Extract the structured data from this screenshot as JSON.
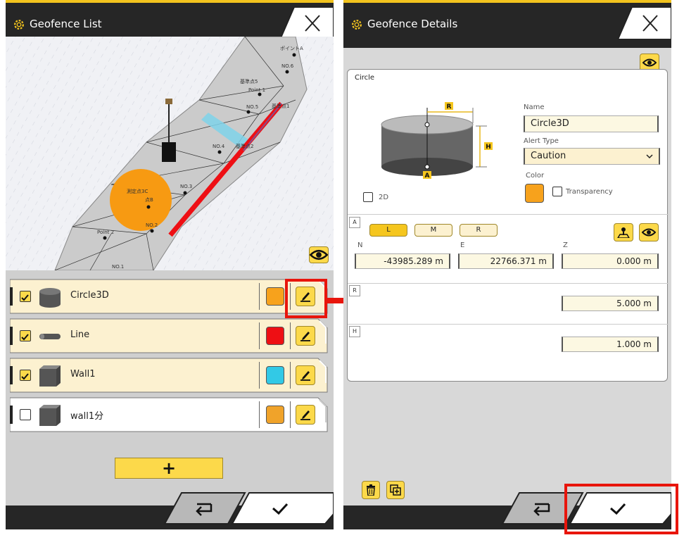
{
  "left": {
    "title": "Geofence List",
    "map_labels": [
      "ポイントA",
      "NO.6",
      "基準点5",
      "Point 1",
      "NO.5",
      "基準点1",
      "NO.4",
      "基準点2",
      "NO.3",
      "Point 2",
      "NO.2",
      "NO.1",
      "測定点3C",
      "点B"
    ],
    "items": [
      {
        "name": "Circle3D",
        "checked": true,
        "color": "#f7a21c",
        "icon": "cylinder-icon"
      },
      {
        "name": "Line",
        "checked": true,
        "color": "#ee0f14",
        "icon": "line-icon"
      },
      {
        "name": "Wall1",
        "checked": true,
        "color": "#32c9e6",
        "icon": "box-icon"
      },
      {
        "name": "wall1分",
        "checked": false,
        "color": "#f0a32a",
        "icon": "box-icon"
      }
    ],
    "add_label": "+"
  },
  "right": {
    "title": "Geofence Details",
    "tab_label": "Circle",
    "diagram_labels": {
      "r": "R",
      "h": "H",
      "a": "A"
    },
    "name_label": "Name",
    "name_value": "Circle3D",
    "alert_label": "Alert Type",
    "alert_value": "Caution",
    "color_label": "Color",
    "color_value": "#f7a21c",
    "transparency_label": "Transparency",
    "twod_label": "2D",
    "section_a": "A",
    "section_r": "R",
    "section_h": "H",
    "lmr": [
      "L",
      "M",
      "R"
    ],
    "coord_labels": {
      "n": "N",
      "e": "E",
      "z": "Z"
    },
    "n_value": "-43985.289 m",
    "e_value": "22766.371 m",
    "z_value": "0.000 m",
    "r_value": "5.000 m",
    "h_value": "1.000 m"
  },
  "colors": {
    "accent": "#fcd94a",
    "dark": "#262626",
    "highlight": "#e8150c"
  }
}
